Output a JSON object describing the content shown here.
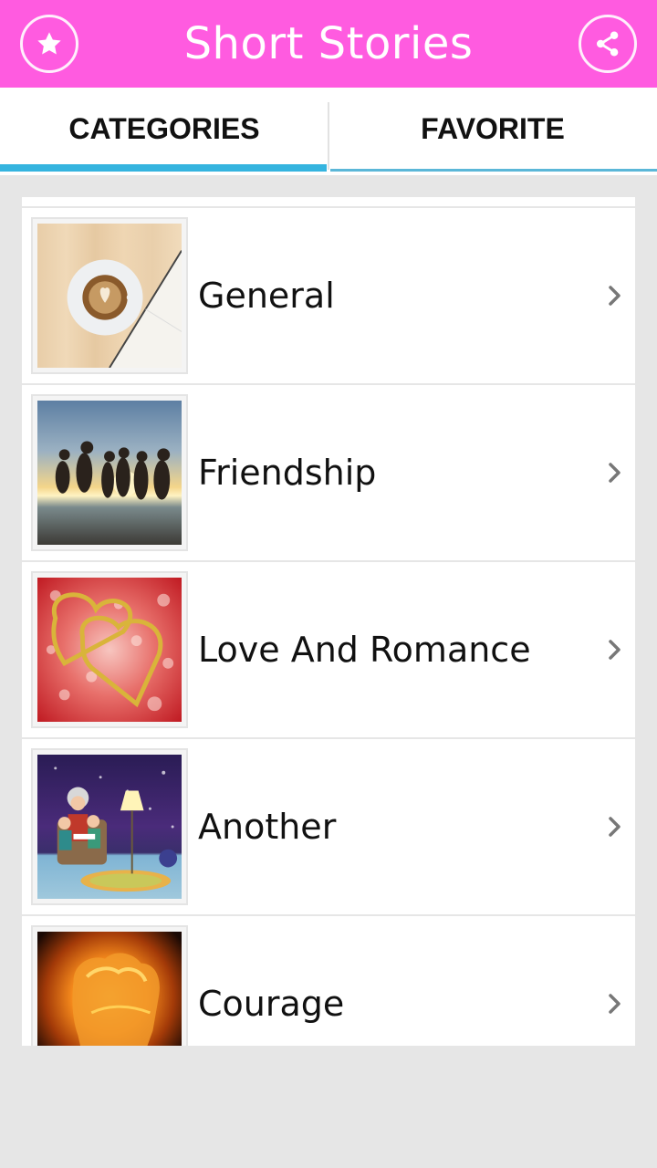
{
  "app_bar": {
    "title": "Short Stories",
    "left_icon": "star-icon",
    "right_icon": "share-icon",
    "color": "#ff5be0"
  },
  "tabs": [
    {
      "label": "CATEGORIES",
      "selected": true
    },
    {
      "label": "FAVORITE",
      "selected": false
    }
  ],
  "tab_indicator_color": "#35b4df",
  "categories": [
    {
      "label": "General",
      "image": "coffee-and-book-image"
    },
    {
      "label": "Friendship",
      "image": "friends-jumping-sunset-image"
    },
    {
      "label": "Love And Romance",
      "image": "golden-hearts-image"
    },
    {
      "label": "Another",
      "image": "grandmother-reading-image"
    },
    {
      "label": "Courage",
      "image": "fiery-fist-image"
    }
  ]
}
